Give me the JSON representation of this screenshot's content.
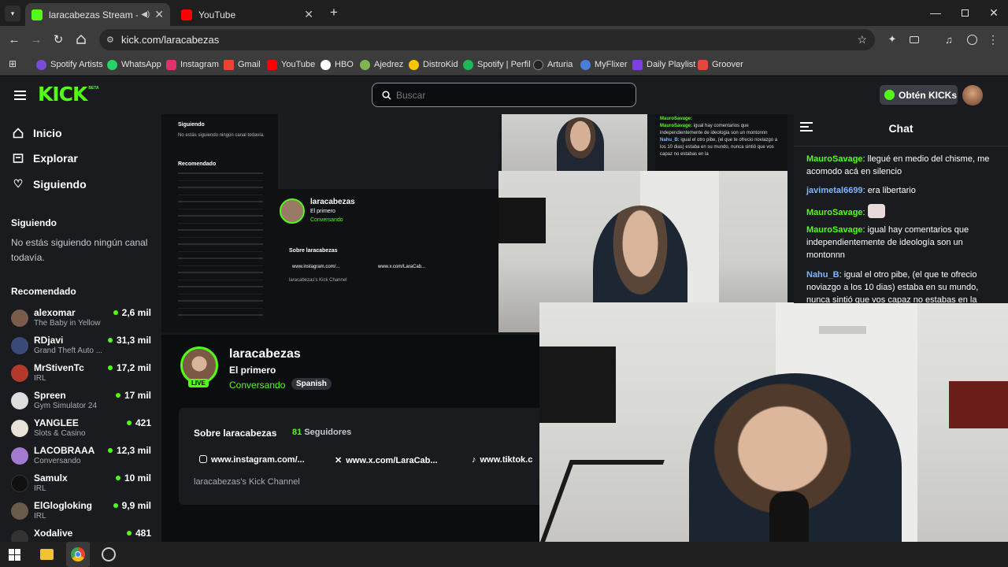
{
  "browser": {
    "tabs": [
      {
        "title": "laracabezas Stream - Watch",
        "favicon_color": "#53fc18"
      },
      {
        "title": "YouTube",
        "favicon_color": "#ff0000"
      }
    ],
    "url": "kick.com/laracabezas",
    "bookmarks": [
      {
        "label": "Spotify Artists",
        "color": "#7a4bd8"
      },
      {
        "label": "WhatsApp",
        "color": "#25d366"
      },
      {
        "label": "Instagram",
        "color": "#e1306c"
      },
      {
        "label": "Gmail",
        "color": "#ea4335"
      },
      {
        "label": "YouTube",
        "color": "#ff0000"
      },
      {
        "label": "HBO",
        "color": "#ffffff"
      },
      {
        "label": "Ajedrez",
        "color": "#81b64c"
      },
      {
        "label": "DistroKid",
        "color": "#f9c400"
      },
      {
        "label": "Spotify | Perfil",
        "color": "#1db954"
      },
      {
        "label": "Arturia",
        "color": "#222222"
      },
      {
        "label": "MyFlixer",
        "color": "#4a7cdc"
      },
      {
        "label": "Daily Playlist",
        "color": "#7b3fe4"
      },
      {
        "label": "Groover",
        "color": "#e4483b"
      }
    ]
  },
  "header": {
    "logo": "KICK",
    "logo_badge": "BETA",
    "search_placeholder": "Buscar",
    "get_kicks_label": "Obtén KICKs"
  },
  "sidebar": {
    "nav": [
      {
        "label": "Inicio",
        "icon": "home-icon"
      },
      {
        "label": "Explorar",
        "icon": "compass-icon"
      },
      {
        "label": "Siguiendo",
        "icon": "heart-icon"
      }
    ],
    "following_title": "Siguiendo",
    "following_empty": "No estás siguiendo ningún canal todavía.",
    "recommended_title": "Recomendado",
    "channels": [
      {
        "name": "alexomar",
        "category": "The Baby in Yellow",
        "viewers": "2,6 mil",
        "avatar": "#7b5c4a"
      },
      {
        "name": "RDjavi",
        "category": "Grand Theft Auto ...",
        "viewers": "31,3 mil",
        "avatar": "#3a4b7a"
      },
      {
        "name": "MrStivenTc",
        "category": "IRL",
        "viewers": "17,2 mil",
        "avatar": "#b33a2a"
      },
      {
        "name": "Spreen",
        "category": "Gym Simulator 24",
        "viewers": "17 mil",
        "avatar": "#dddddd"
      },
      {
        "name": "YANGLEE",
        "category": "Slots & Casino",
        "viewers": "421",
        "avatar": "#e8e2d8"
      },
      {
        "name": "LACOBRAAA",
        "category": "Conversando",
        "viewers": "12,3 mil",
        "avatar": "#a37ad0"
      },
      {
        "name": "Samulx",
        "category": "IRL",
        "viewers": "10 mil",
        "avatar": "#111111"
      },
      {
        "name": "ElGlogloking",
        "category": "IRL",
        "viewers": "9,9 mil",
        "avatar": "#6a5a4a"
      },
      {
        "name": "Xodalive",
        "category": "",
        "viewers": "481",
        "avatar": "#333333"
      }
    ]
  },
  "channel": {
    "name": "laracabezas",
    "title": "El primero",
    "category": "Conversando",
    "language": "Spanish",
    "live_badge": "LIVE",
    "about_title": "Sobre laracabezas",
    "followers": "81",
    "followers_label": "Seguidores",
    "links": [
      "www.instagram.com/...",
      "www.x.com/LaraCab...",
      "www.tiktok.c"
    ],
    "description": "laracabezas's Kick Channel"
  },
  "chat": {
    "title": "Chat",
    "messages": [
      {
        "user": "MauroSavage",
        "color": "#53fc18",
        "text": "llegué en medio del chisme, me acomodo acá en silencio"
      },
      {
        "user": "javimetal6699",
        "color": "#7fb7ff",
        "text": "era libertario"
      },
      {
        "user": "MauroSavage",
        "color": "#53fc18",
        "text": "",
        "emote": true
      },
      {
        "user": "MauroSavage",
        "color": "#53fc18",
        "text": "igual hay comentarios que independientemente de ideología son un montonnn"
      },
      {
        "user": "Nahu_B",
        "color": "#7fb7ff",
        "text": "igual el otro pibe, (el que te ofrecio noviazgo a los 10 dias) estaba en su mundo, nunca sintió que vos capaz no estabas en la"
      }
    ]
  },
  "mini": {
    "following_title": "Siguiendo",
    "following_empty": "No estás siguiendo ningún canal todavía.",
    "recommended_title": "Recomendado",
    "chat_lines": [
      {
        "user": "MauroSavage:",
        "text": ""
      },
      {
        "user": "MauroSavage:",
        "text": "igual hay comentarios que independientemente de ideologia son un montonnn"
      },
      {
        "user": "Nahu_B:",
        "text": "igual el otro pibe, (el que te ofrecio noviazgo a los 10 dias) estaba en su mundo, nunca sintió que vos capaz no estabas en la"
      }
    ]
  },
  "colors": {
    "kick_green": "#53fc18",
    "bg": "#0b0e0f",
    "panel": "#191b1f"
  }
}
